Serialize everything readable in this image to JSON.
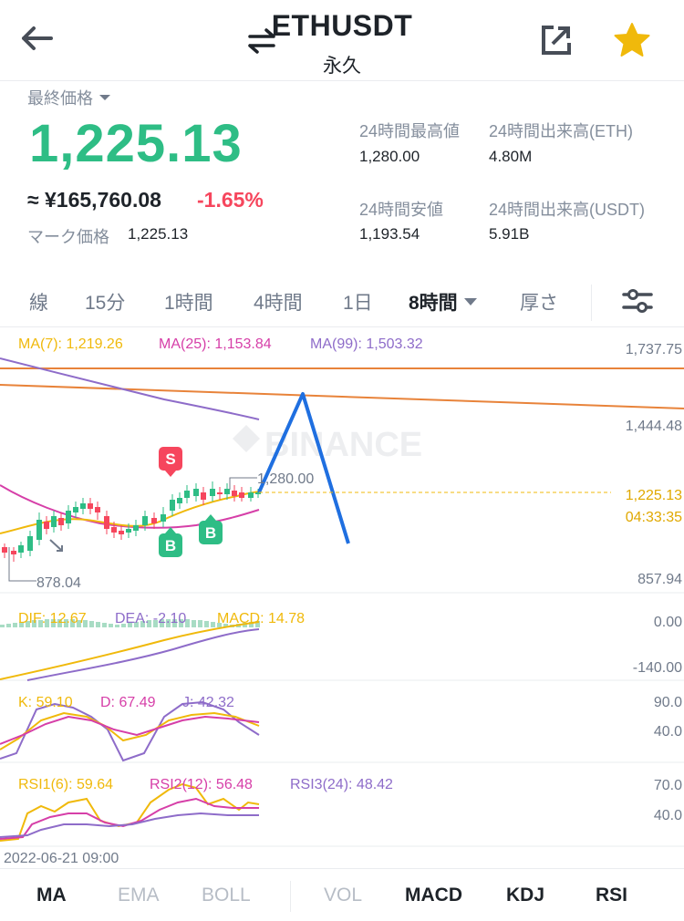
{
  "header": {
    "symbol": "ETHUSDT",
    "contract_type": "永久",
    "back_icon": "arrow-left-icon",
    "swap_icon": "swap-arrows-icon",
    "share_icon": "share-icon",
    "favorite_icon": "star-icon",
    "favorite_color": "#f0b90b"
  },
  "ticker": {
    "last_price_label": "最終価格",
    "last_price": "1,225.13",
    "approx_value": "≈ ¥165,760.08",
    "change_percent": "-1.65%",
    "mark_price_label": "マーク価格",
    "mark_price": "1,225.13",
    "up_color": "#2ebd85",
    "down_color": "#f6465d",
    "stats": [
      {
        "label": "24時間最高値",
        "value": "1,280.00"
      },
      {
        "label": "24時間出来高(ETH)",
        "value": "4.80M"
      },
      {
        "label": "24時間安値",
        "value": "1,193.54"
      },
      {
        "label": "24時間出来高(USDT)",
        "value": "5.91B"
      }
    ]
  },
  "interval_tabs": [
    {
      "label": "線",
      "active": false
    },
    {
      "label": "15分",
      "active": false
    },
    {
      "label": "1時間",
      "active": false
    },
    {
      "label": "4時間",
      "active": false
    },
    {
      "label": "1日",
      "active": false
    },
    {
      "label": "8時間",
      "active": true
    },
    {
      "label": "厚さ",
      "active": false
    }
  ],
  "settings_icon": "sliders-icon",
  "chart": {
    "watermark": "BINANCE",
    "ma_legend": [
      {
        "text": "MA(7): 1,219.26",
        "color": "#f0b90b"
      },
      {
        "text": "MA(25): 1,153.84",
        "color": "#d63fa8"
      },
      {
        "text": "MA(99): 1,503.32",
        "color": "#8e6cc9"
      }
    ],
    "price_axis": [
      "1,737.75",
      "1,444.48",
      "857.94"
    ],
    "current_price": "1,225.13",
    "countdown": "04:33:35",
    "high_marker": "1,280.00",
    "low_marker": "878.04",
    "sell_marker": "S",
    "buy_marker": "B",
    "macd_legend": [
      {
        "text": "DIF: 12.67",
        "color": "#f0b90b"
      },
      {
        "text": "DEA: -2.10",
        "color": "#8e6cc9"
      },
      {
        "text": "MACD: 14.78",
        "color": "#f0b90b"
      }
    ],
    "macd_axis": [
      "0.00",
      "-140.00"
    ],
    "kdj_legend": [
      {
        "text": "K: 59.10",
        "color": "#f0b90b"
      },
      {
        "text": "D: 67.49",
        "color": "#d63fa8"
      },
      {
        "text": "J: 42.32",
        "color": "#8e6cc9"
      }
    ],
    "kdj_axis": [
      "90.0",
      "40.0"
    ],
    "rsi_legend": [
      {
        "text": "RSI1(6): 59.64",
        "color": "#f0b90b"
      },
      {
        "text": "RSI2(12): 56.48",
        "color": "#d63fa8"
      },
      {
        "text": "RSI3(24): 48.42",
        "color": "#8e6cc9"
      }
    ],
    "rsi_axis": [
      "70.0",
      "40.0"
    ],
    "date_label": "2022-06-21 09:00"
  },
  "indicator_tabs": [
    {
      "label": "MA",
      "active": true
    },
    {
      "label": "EMA",
      "active": false
    },
    {
      "label": "BOLL",
      "active": false
    },
    {
      "label": "VOL",
      "active": false
    },
    {
      "label": "MACD",
      "active": true
    },
    {
      "label": "KDJ",
      "active": true
    },
    {
      "label": "RSI",
      "active": true
    }
  ]
}
